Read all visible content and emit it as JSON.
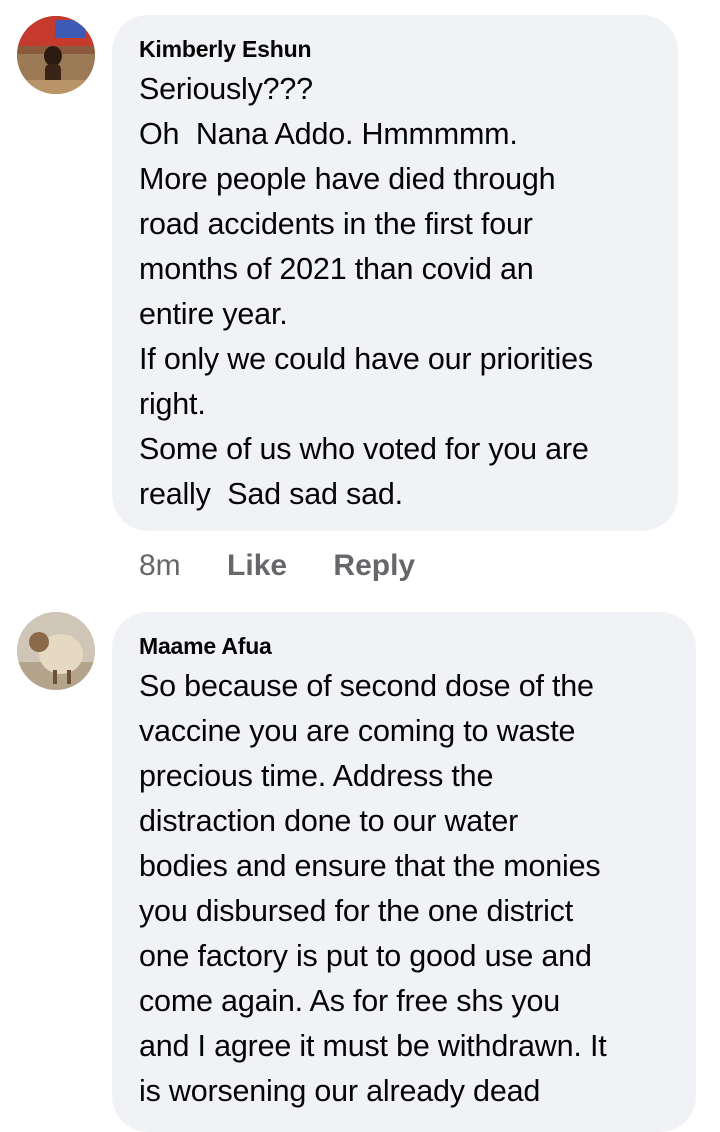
{
  "comments": [
    {
      "author": "Kimberly Eshun",
      "lines": [
        "Seriously???",
        "Oh  Nana Addo. Hmmmmm.",
        "More people have died through",
        "road accidents in the first four",
        "months of 2021 than covid an",
        "entire year.",
        "If only we could have our priorities",
        "right.",
        "Some of us who voted for you are",
        "really  Sad sad sad."
      ],
      "time": "8m",
      "like_label": "Like",
      "reply_label": "Reply"
    },
    {
      "author": "Maame Afua",
      "lines": [
        "So because of second dose of the",
        "vaccine you are coming to waste",
        "precious time. Address the",
        "distraction done to our water",
        "bodies and ensure that the monies",
        "you disbursed for the one district",
        "one factory is put to good use and",
        "come again. As for free shs you",
        "and I agree it must be withdrawn. It",
        "is worsening our already dead"
      ]
    }
  ],
  "colors": {
    "bubble_bg": "#f0f2f5",
    "text": "#050505",
    "secondary_text": "#65676b"
  }
}
